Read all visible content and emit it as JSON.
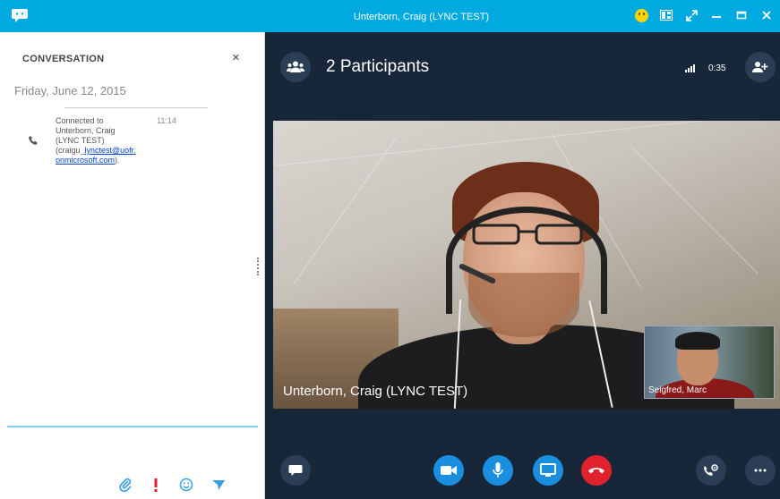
{
  "window": {
    "title": "Unterborn, Craig (LYNC TEST)"
  },
  "conversation": {
    "heading": "CONVERSATION",
    "close_glyph": "×",
    "date": "Friday, June 12, 2015",
    "message": {
      "line1": "Connected to",
      "line2": "Unterborn, Craig",
      "line3": "(LYNC TEST)",
      "email_prefix": "(craigu_",
      "email_link_part1": "lynctest@uofr.",
      "email_link_part2": "onmicrosoft.com",
      "email_suffix": ").",
      "time": "11:14"
    }
  },
  "call": {
    "participants_label": "2 Participants",
    "duration": "0:35",
    "main_video_name": "Unterborn, Craig (LYNC TEST)",
    "pip_name": "Seigfred, Marc"
  },
  "colors": {
    "titlebar": "#00a9e0",
    "call_button_blue": "#1a8fe0",
    "hangup_red": "#e0222c",
    "important_red": "#e0222c"
  },
  "icons": {
    "app": "chat-bubble-icon",
    "emoji": "smiley-icon",
    "layout": "layout-icon",
    "fullscreen": "expand-icon",
    "minimize": "minimize-icon",
    "maximize": "maximize-icon",
    "close": "close-icon",
    "participants": "people-icon",
    "add_participant": "add-person-icon",
    "signal": "signal-icon",
    "attach": "paperclip-icon",
    "important": "exclamation-icon",
    "emoticon": "emoticon-icon",
    "send": "send-icon",
    "chat": "chat-icon",
    "video": "video-camera-icon",
    "mic": "microphone-icon",
    "present": "monitor-icon",
    "hangup": "hangup-icon",
    "dialpad": "phone-settings-icon",
    "more": "more-icon"
  }
}
